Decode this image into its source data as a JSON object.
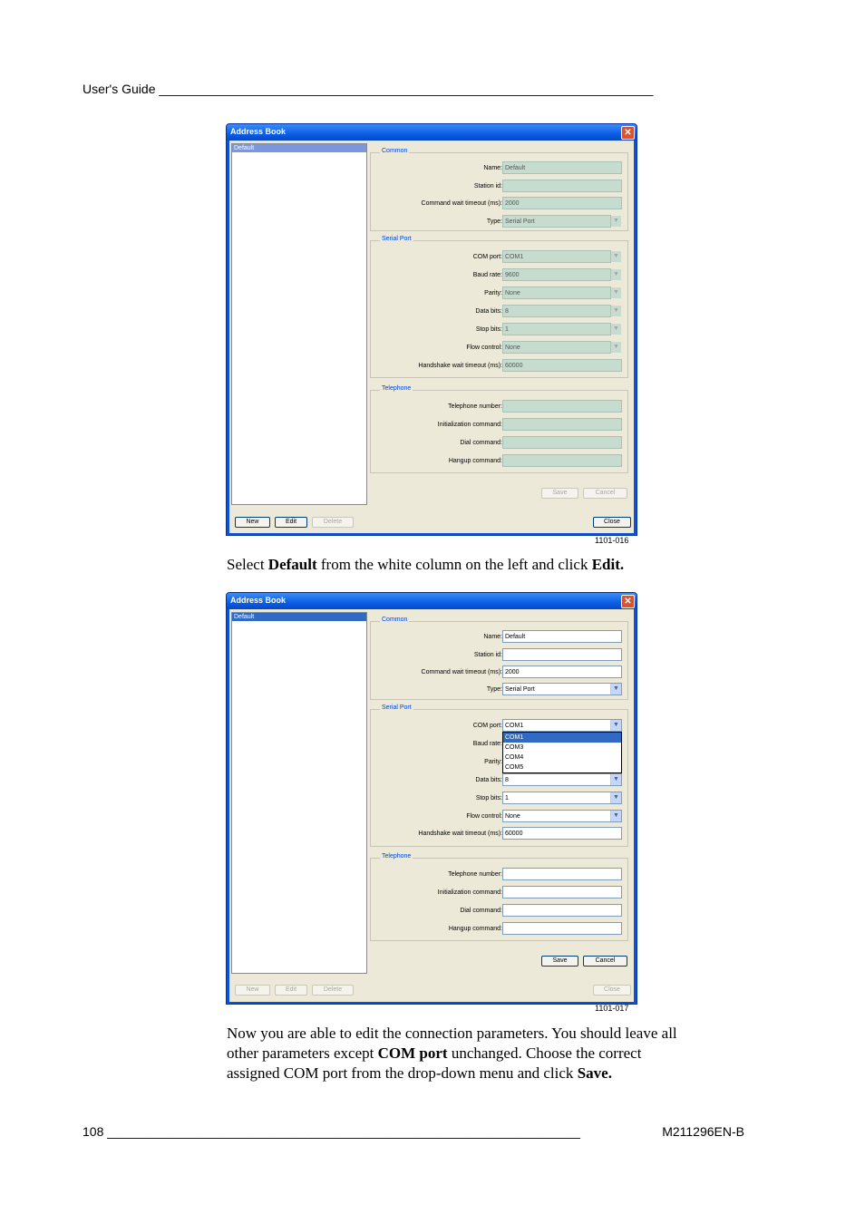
{
  "page": {
    "header": "User's Guide ______________________________________________________________________",
    "footer_left": "108 ___________________________________________________________________",
    "footer_right": "M211296EN-B"
  },
  "figure1": {
    "caption": "1101-016",
    "window_title": "Address Book",
    "list_items": [
      "Default"
    ],
    "common_legend": "Common",
    "common": [
      {
        "label": "Name:",
        "value": "Default"
      },
      {
        "label": "Station id:",
        "value": ""
      },
      {
        "label": "Command wait timeout (ms):",
        "value": "2000"
      },
      {
        "label": "Type:",
        "value": "Serial Port"
      }
    ],
    "serial_legend": "Serial Port",
    "serial": [
      {
        "label": "COM port:",
        "value": "COM1"
      },
      {
        "label": "Baud rate:",
        "value": "9600"
      },
      {
        "label": "Parity:",
        "value": "None"
      },
      {
        "label": "Data bits:",
        "value": "8"
      },
      {
        "label": "Stop bits:",
        "value": "1"
      },
      {
        "label": "Flow control:",
        "value": "None"
      },
      {
        "label": "Handshake wait timeout (ms):",
        "value": "60000"
      }
    ],
    "telephone_legend": "Telephone",
    "telephone": [
      {
        "label": "Telephone number:",
        "value": ""
      },
      {
        "label": "Initialization command:",
        "value": ""
      },
      {
        "label": "Dial command:",
        "value": ""
      },
      {
        "label": "Hangup command:",
        "value": ""
      }
    ],
    "buttons": {
      "save": "Save",
      "cancel": "Cancel",
      "new": "New",
      "edit": "Edit",
      "delete": "Delete",
      "close": "Close"
    }
  },
  "text1": {
    "p1": "Select ",
    "b1": "Default",
    "p2": " from the white column on the left and click ",
    "b2": "Edit."
  },
  "figure2": {
    "caption": "1101-017",
    "window_title": "Address Book",
    "list_items": [
      "Default"
    ],
    "common_legend": "Common",
    "common": [
      {
        "label": "Name:",
        "value": "Default"
      },
      {
        "label": "Station id:",
        "value": ""
      },
      {
        "label": "Command wait timeout (ms):",
        "value": "2000"
      },
      {
        "label": "Type:",
        "value": "Serial Port"
      }
    ],
    "serial_legend": "Serial Port",
    "serial": [
      {
        "label": "COM port:",
        "value": "COM1"
      },
      {
        "label": "Baud rate:",
        "value": ""
      },
      {
        "label": "Parity:",
        "value": ""
      },
      {
        "label": "Data bits:",
        "value": "8"
      },
      {
        "label": "Stop bits:",
        "value": "1"
      },
      {
        "label": "Flow control:",
        "value": "None"
      },
      {
        "label": "Handshake wait timeout (ms):",
        "value": "60000"
      }
    ],
    "com_options": [
      "COM1",
      "COM3",
      "COM4",
      "COM5"
    ],
    "telephone_legend": "Telephone",
    "telephone": [
      {
        "label": "Telephone number:",
        "value": ""
      },
      {
        "label": "Initialization command:",
        "value": ""
      },
      {
        "label": "Dial command:",
        "value": ""
      },
      {
        "label": "Hangup command:",
        "value": ""
      }
    ],
    "buttons": {
      "save": "Save",
      "cancel": "Cancel",
      "new": "New",
      "edit": "Edit",
      "delete": "Delete",
      "close": "Close"
    }
  },
  "text2": {
    "l1": "Now you are able to edit the connection parameters. You should leave all",
    "l2a": "other parameters except ",
    "l2b": "COM port",
    "l2c": " unchanged. Choose the correct",
    "l3a": "assigned COM port from the drop-down menu and click ",
    "l3b": "Save."
  }
}
